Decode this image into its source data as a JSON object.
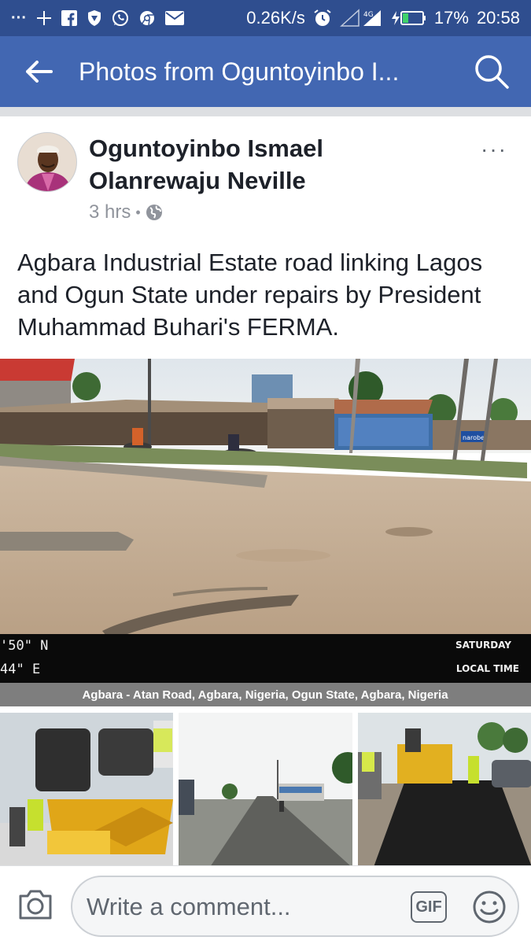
{
  "status_bar": {
    "notifications_overflow": "···",
    "network_speed": "0.26K/s",
    "battery_percent": "17%",
    "time": "20:58"
  },
  "app_bar": {
    "title": "Photos from Oguntoyinbo I..."
  },
  "post": {
    "author": "Oguntoyinbo Ismael Olanrewaju Neville",
    "timestamp": "3 hrs",
    "separator": "•",
    "more_label": "···",
    "caption": "Agbara Industrial Estate road linking Lagos and Ogun State under repairs by President Muhammad Buhari's FERMA.",
    "main_photo": {
      "overlay_coord_top": "'50\" N",
      "overlay_coord_bottom": "44\" E",
      "overlay_day": "SATURDAY",
      "overlay_time_label": "LOCAL TIME",
      "overlay_location": "Agbara - Atan Road, Agbara, Nigeria, Ogun State, Agbara, Nigeria",
      "shop_sign": "narobet"
    }
  },
  "comment_bar": {
    "placeholder": "Write a comment...",
    "gif_label": "GIF"
  },
  "colors": {
    "status_bar": "#2f4e8f",
    "app_bar": "#4267b2",
    "text_primary": "#1d2129",
    "text_secondary": "#90949c"
  },
  "icons": [
    "plus-icon",
    "facebook-icon",
    "shield-icon",
    "whatsapp-icon",
    "chrome-icon",
    "mail-icon",
    "alarm-icon",
    "signal-icon",
    "battery-icon",
    "back-arrow-icon",
    "search-icon",
    "globe-icon",
    "camera-icon",
    "gif-icon",
    "emoji-icon"
  ]
}
